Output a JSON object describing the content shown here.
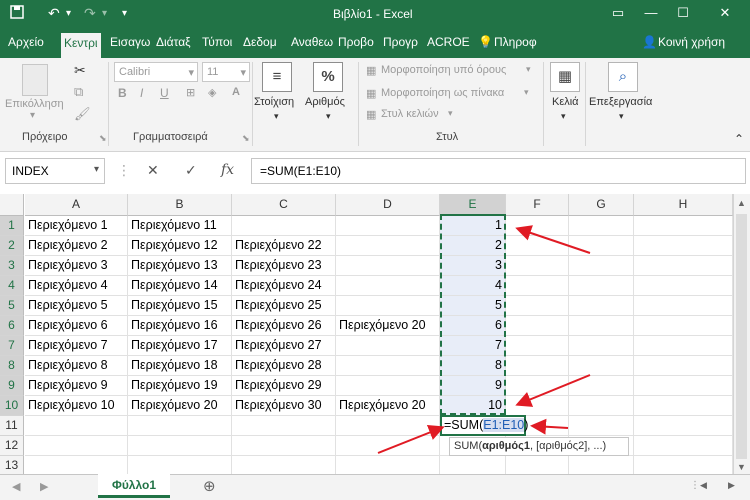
{
  "title_bar": {
    "title": "Βιβλίο1 - Excel",
    "save_icon": "save-icon",
    "undo_icon": "undo-icon",
    "redo_icon": "redo-icon"
  },
  "tabs": [
    "Αρχείο",
    "Κεντρι",
    "Εισαγω",
    "Διάταξ",
    "Τύποι",
    "Δεδομ",
    "Αναθεω",
    "Προβο",
    "Προγρ",
    "ACROE"
  ],
  "tell_me": "Πληροφ",
  "share": "Κοινή χρήση",
  "ribbon": {
    "paste": "Επικόλληση",
    "clipboard": "Πρόχειρο",
    "font_name": "Calibri",
    "font_size": "11",
    "font_group": "Γραμματοσειρά",
    "alignment": "Στοίχιση",
    "number": "Αριθμός",
    "number_symbol": "%",
    "cond_format": "Μορφοποίηση υπό όρους",
    "format_table": "Μορφοποίηση ως πίνακα",
    "cell_styles": "Στυλ κελιών",
    "styles_group": "Στυλ",
    "cells": "Κελιά",
    "editing": "Επεξεργασία"
  },
  "formula_bar": {
    "name_box": "INDEX",
    "fx": "fx",
    "formula": "=SUM(E1:E10)"
  },
  "columns": [
    "A",
    "B",
    "C",
    "D",
    "E",
    "F",
    "G",
    "H"
  ],
  "rows": [
    "1",
    "2",
    "3",
    "4",
    "5",
    "6",
    "7",
    "8",
    "9",
    "10",
    "11",
    "12",
    "13"
  ],
  "cells": {
    "A": [
      "Περιεχόμενο 1",
      "Περιεχόμενο 2",
      "Περιεχόμενο 3",
      "Περιεχόμενο 4",
      "Περιεχόμενο 5",
      "Περιεχόμενο 6",
      "Περιεχόμενο 7",
      "Περιεχόμενο 8",
      "Περιεχόμενο 9",
      "Περιεχόμενο 10"
    ],
    "B": [
      "Περιεχόμενο 11",
      "Περιεχόμενο 12",
      "Περιεχόμενο 13",
      "Περιεχόμενο 14",
      "Περιεχόμενο 15",
      "Περιεχόμενο 16",
      "Περιεχόμενο 17",
      "Περιεχόμενο 18",
      "Περιεχόμενο 19",
      "Περιεχόμενο 20"
    ],
    "C": [
      "",
      "Περιεχόμενο 22",
      "Περιεχόμενο 23",
      "Περιεχόμενο 24",
      "Περιεχόμενο 25",
      "Περιεχόμενο 26",
      "Περιεχόμενο 27",
      "Περιεχόμενο 28",
      "Περιεχόμενο 29",
      "Περιεχόμενο 30"
    ],
    "D": [
      "",
      "",
      "",
      "",
      "",
      "Περιεχόμενο 20",
      "",
      "",
      "",
      "Περιεχόμενο 20"
    ],
    "E": [
      "1",
      "2",
      "3",
      "4",
      "5",
      "6",
      "7",
      "8",
      "9",
      "10"
    ]
  },
  "editing_cell": {
    "prefix": "=SUM(",
    "range": "E1:E10",
    "suffix": ")"
  },
  "tooltip": {
    "fn": "SUM(",
    "arg1": "αριθμός1",
    "rest": ", [αριθμός2], ...)"
  },
  "sheet_tab": "Φύλλο1",
  "colors": {
    "accent": "#217346",
    "annotation": "#e01b24",
    "range_blue": "#1f5eb5"
  }
}
